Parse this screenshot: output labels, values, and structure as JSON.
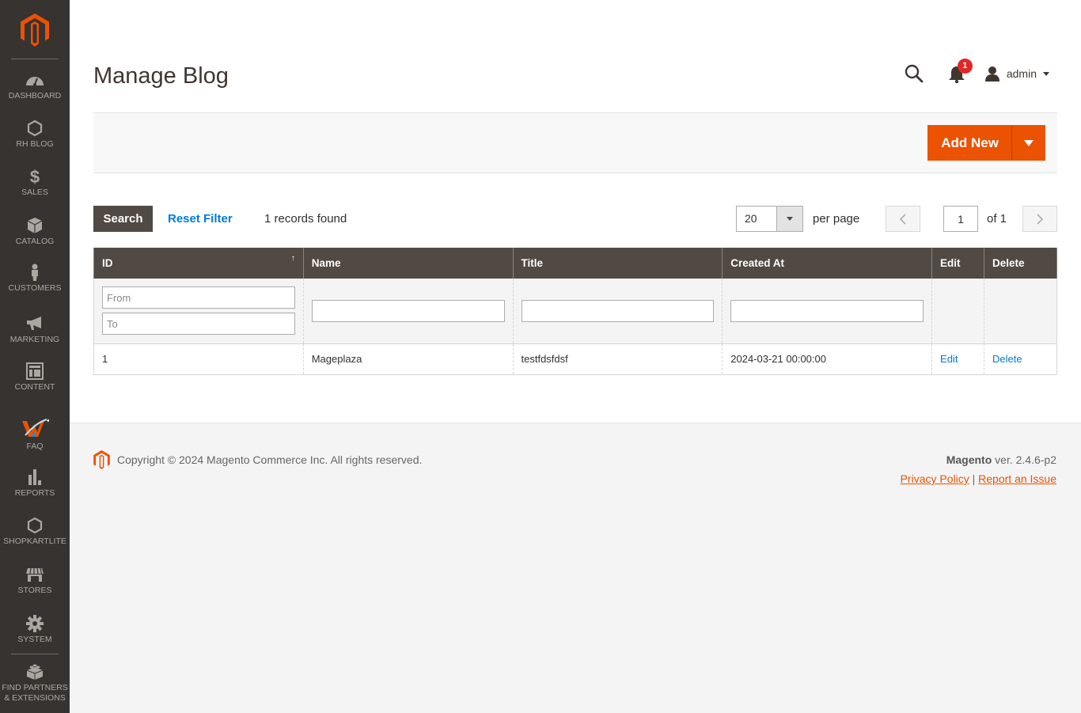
{
  "sidebar": {
    "items": [
      {
        "label": "Dashboard",
        "icon": "dashboard-icon"
      },
      {
        "label": "RH Blog",
        "icon": "hexagon-icon"
      },
      {
        "label": "Sales",
        "icon": "dollar-icon"
      },
      {
        "label": "Catalog",
        "icon": "box-icon"
      },
      {
        "label": "Customers",
        "icon": "person-icon"
      },
      {
        "label": "Marketing",
        "icon": "megaphone-icon"
      },
      {
        "label": "Content",
        "icon": "layout-icon"
      },
      {
        "label": "FAQ",
        "icon": "faq-logo-icon"
      },
      {
        "label": "Reports",
        "icon": "bar-chart-icon"
      },
      {
        "label": "Shopkartlite",
        "icon": "hexagon-icon"
      },
      {
        "label": "Stores",
        "icon": "storefront-icon"
      },
      {
        "label": "System",
        "icon": "gear-icon"
      },
      {
        "label": "Find Partners & Extensions",
        "icon": "lego-brick-icon"
      }
    ]
  },
  "header": {
    "title": "Manage Blog",
    "notifications_count": "1",
    "user_name": "admin"
  },
  "actions": {
    "add_new_label": "Add New"
  },
  "grid_controls": {
    "search_label": "Search",
    "reset_filter_label": "Reset Filter",
    "records_found": "1 records found",
    "per_page_value": "20",
    "per_page_label": "per page",
    "current_page": "1",
    "total_pages_label": "of 1"
  },
  "table": {
    "columns": [
      "ID",
      "Name",
      "Title",
      "Created At",
      "Edit",
      "Delete"
    ],
    "sort_indicator": "↑",
    "filters": {
      "id_from_placeholder": "From",
      "id_to_placeholder": "To"
    },
    "rows": [
      {
        "id": "1",
        "name": "Mageplaza",
        "title": "testfdsfdsf",
        "created_at": "2024-03-21 00:00:00",
        "edit": "Edit",
        "delete": "Delete"
      }
    ]
  },
  "footer": {
    "copyright": "Copyright © 2024 Magento Commerce Inc. All rights reserved.",
    "brand": "Magento",
    "version": " ver. 2.4.6-p2",
    "privacy_link": "Privacy Policy",
    "separator": " | ",
    "report_link": "Report an Issue"
  },
  "colors": {
    "accent": "#eb5202",
    "sidebar_bg": "#373330",
    "table_header_bg": "#514943",
    "link": "#007bdb",
    "badge": "#e22626"
  }
}
